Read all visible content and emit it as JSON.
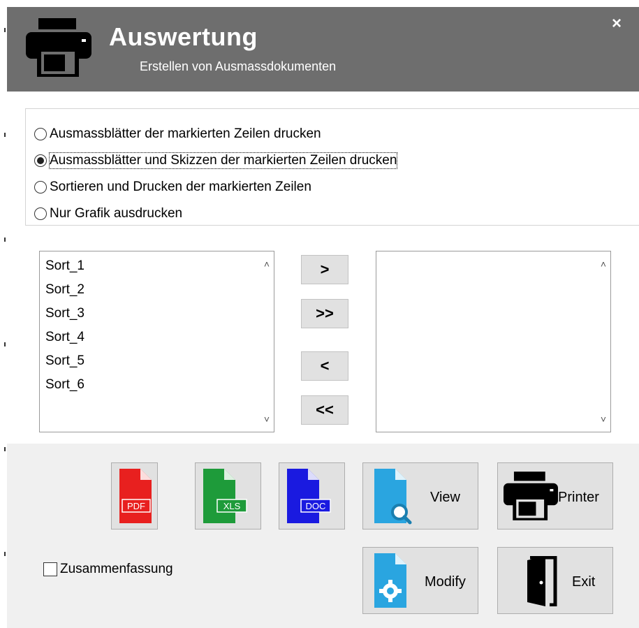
{
  "header": {
    "title": "Auswertung",
    "subtitle": "Erstellen von Ausmassdokumenten",
    "close_label": "×"
  },
  "options": [
    {
      "label": "Ausmassblätter der markierten Zeilen drucken",
      "checked": false
    },
    {
      "label": "Ausmassblätter und Skizzen der markierten Zeilen drucken",
      "checked": true
    },
    {
      "label": "Sortieren und Drucken der markierten Zeilen",
      "checked": false
    },
    {
      "label": "Nur Grafik ausdrucken",
      "checked": false
    }
  ],
  "available_list": [
    "Sort_1",
    "Sort_2",
    "Sort_3",
    "Sort_4",
    "Sort_5",
    "Sort_6"
  ],
  "selected_list": [],
  "move_buttons": {
    "add_one": ">",
    "add_all": ">>",
    "remove_one": "<",
    "remove_all": "<<"
  },
  "actions": {
    "pdf_label": "PDF",
    "xls_label": "XLS",
    "doc_label": "DOC",
    "view_label": "View",
    "printer_label": "Printer",
    "modify_label": "Modify",
    "exit_label": "Exit"
  },
  "summary_checkbox": {
    "label": "Zusammenfassung",
    "checked": false
  },
  "colors": {
    "header_bg": "#6e6e6e",
    "pdf": "#e8201f",
    "xls": "#1e9b3a",
    "doc": "#1a1ae0",
    "view": "#2aa5e0"
  }
}
